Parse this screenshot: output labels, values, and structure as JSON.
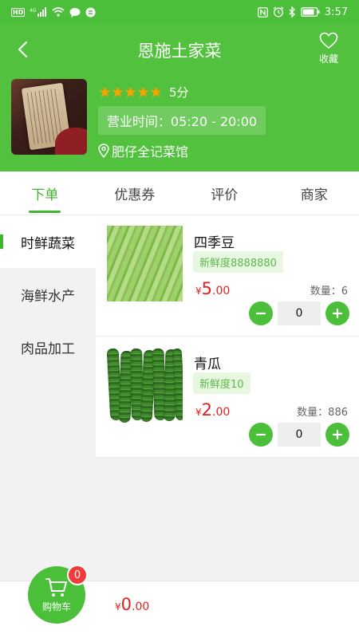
{
  "status_bar": {
    "time": "3:57",
    "signal_label": "4G",
    "left_icons": [
      "hd-icon",
      "signal-icon",
      "wifi-icon",
      "message-icon",
      "app-icon"
    ],
    "right_icons": [
      "nfc-icon",
      "alarm-icon",
      "bluetooth-icon",
      "battery-icon"
    ]
  },
  "header": {
    "title": "恩施土家菜",
    "favorite_label": "收藏",
    "rating_stars": 5,
    "rating_text": "5分",
    "hours": "营业时间：05:20 - 20:00",
    "address": "肥仔全记菜馆",
    "bg_color": "#52c13e"
  },
  "tabs": [
    {
      "label": "下单",
      "active": true
    },
    {
      "label": "优惠券",
      "active": false
    },
    {
      "label": "评价",
      "active": false
    },
    {
      "label": "商家",
      "active": false
    }
  ],
  "categories": [
    {
      "label": "时鲜蔬菜",
      "active": true
    },
    {
      "label": "海鲜水产",
      "active": false
    },
    {
      "label": "肉品加工",
      "active": false
    }
  ],
  "products": [
    {
      "name": "四季豆",
      "freshness": "新鲜度8888880",
      "price_symbol": "¥",
      "price_int": "5",
      "price_dec": ".00",
      "stock": "数量：6",
      "quantity": "0",
      "image": "green-beans"
    },
    {
      "name": "青瓜",
      "freshness": "新鲜度10",
      "price_symbol": "¥",
      "price_int": "2",
      "price_dec": ".00",
      "stock": "数量：886",
      "quantity": "0",
      "image": "cucumbers"
    }
  ],
  "cart": {
    "label": "购物车",
    "badge": "0",
    "total_symbol": "¥",
    "total_int": "0",
    "total_dec": ".00"
  },
  "colors": {
    "accent": "#4cbf3a",
    "price": "#e0221f",
    "badge": "#ef3b3b"
  }
}
